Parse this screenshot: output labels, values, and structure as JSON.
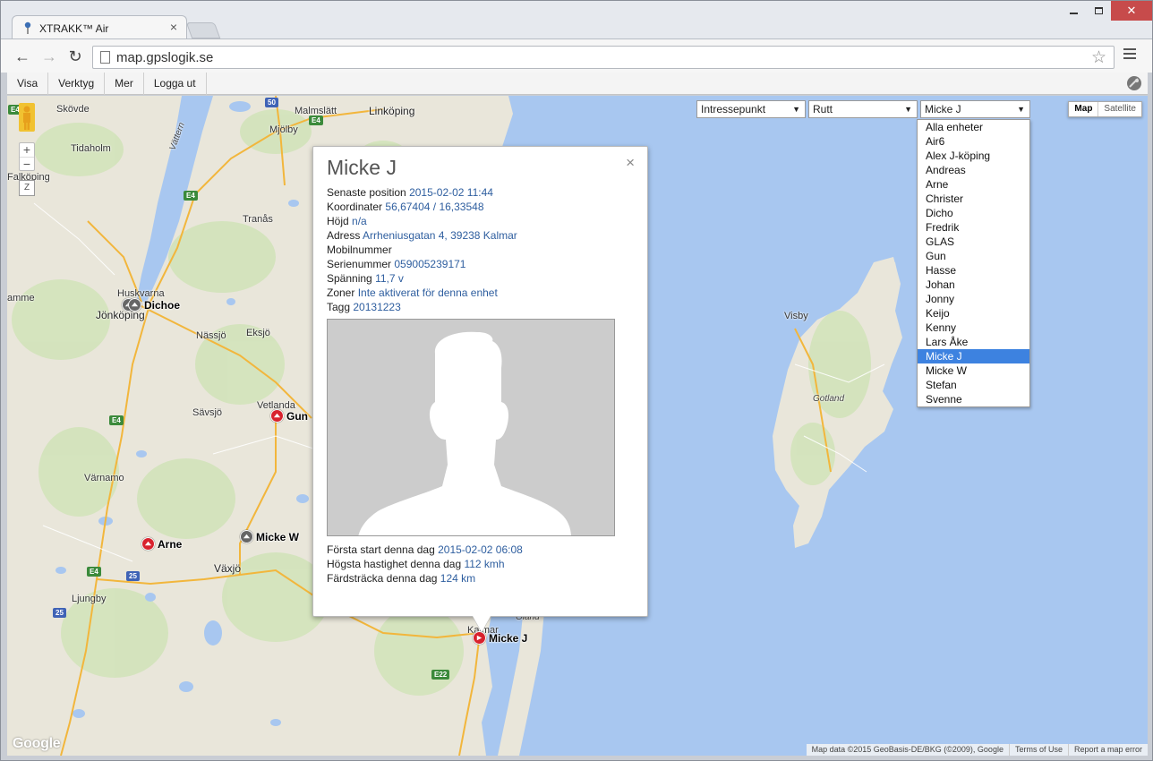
{
  "browser": {
    "tab_title": "XTRAKK™ Air",
    "tab_close": "×",
    "url": "map.gpslogik.se",
    "back": "←",
    "forward": "→",
    "reload": "↻",
    "star": "☆"
  },
  "app_menu": {
    "items": [
      "Visa",
      "Verktyg",
      "Mer",
      "Logga ut"
    ]
  },
  "map": {
    "selects": {
      "poi": "Intressepunkt",
      "route": "Rutt",
      "unit": "Micke J"
    },
    "dropdown_arrow": "▼",
    "unit_options": [
      "Alla enheter",
      "Air6",
      "Alex J-köping",
      "Andreas",
      "Arne",
      "Christer",
      "Dicho",
      "Fredrik",
      "GLAS",
      "Gun",
      "Hasse",
      "Johan",
      "Jonny",
      "Keijo",
      "Kenny",
      "Lars Åke",
      "Micke J",
      "Micke W",
      "Stefan",
      "Svenne"
    ],
    "selected_unit": "Micke J",
    "map_type": {
      "map": "Map",
      "satellite": "Satellite"
    },
    "zoom_in": "+",
    "zoom_out": "−",
    "zoom_slider": "Z",
    "places": {
      "skovde": "Skövde",
      "mariestad": "",
      "malmslatt": "Malmslätt",
      "linkoping": "Linköping",
      "mjolby": "Mjölby",
      "tidaholm": "Tidaholm",
      "falkoping": "Falköping",
      "tranas": "Tranås",
      "huskvarna": "Huskvarna",
      "jonkoping": "Jönköping",
      "nassjo": "Nässjö",
      "eksjo": "Eksjö",
      "vetlanda": "Vetlanda",
      "savsjo": "Sävsjö",
      "varnamo": "Värnamo",
      "vaxjo": "Växjö",
      "ljungby": "Ljungby",
      "kalmar": "Kalmar",
      "oland": "Öland",
      "visby": "Visby",
      "gotland": "Gotland",
      "vattern": "Vättern",
      "amme": "amme"
    },
    "roads": [
      "E4",
      "E4",
      "E4",
      "E4",
      "E22",
      "25",
      "25",
      "50",
      "E4"
    ],
    "markers": [
      {
        "label": "Dichoe",
        "color": "grey"
      },
      {
        "label": "Gun",
        "color": "red"
      },
      {
        "label": "Arne",
        "color": "red"
      },
      {
        "label": "Micke W",
        "color": "grey"
      },
      {
        "label": "Micke J",
        "color": "red"
      }
    ],
    "footer": {
      "attribution": "Map data ©2015 GeoBasis-DE/BKG (©2009), Google",
      "terms": "Terms of Use",
      "report": "Report a map error"
    },
    "google_logo": "Google",
    "colors": {
      "water": "#a8c7f0",
      "land": "#e8e4d6",
      "marker_red": "#d8222d",
      "link": "#2e5e9f",
      "selected": "#3d82e0"
    }
  },
  "info": {
    "title": "Micke J",
    "close": "×",
    "rows": [
      {
        "label": "Senaste position",
        "value": "2015-02-02 11:44"
      },
      {
        "label": "Koordinater",
        "value": "56,67404 / 16,33548"
      },
      {
        "label": "Höjd",
        "value": "n/a"
      },
      {
        "label": "Adress",
        "value": "Arrheniusgatan 4, 39238 Kalmar"
      },
      {
        "label": "Mobilnummer",
        "value": ""
      },
      {
        "label": "Serienummer",
        "value": "059005239171"
      },
      {
        "label": "Spänning",
        "value": "11,7 v"
      },
      {
        "label": "Zoner",
        "value": "Inte aktiverat för denna enhet"
      },
      {
        "label": "Tagg",
        "value": "20131223"
      }
    ],
    "rows2": [
      {
        "label": "Första start denna dag",
        "value": "2015-02-02 06:08"
      },
      {
        "label": "Högsta hastighet denna dag",
        "value": "112 kmh"
      },
      {
        "label": "Färdsträcka denna dag",
        "value": "124 km"
      }
    ]
  }
}
